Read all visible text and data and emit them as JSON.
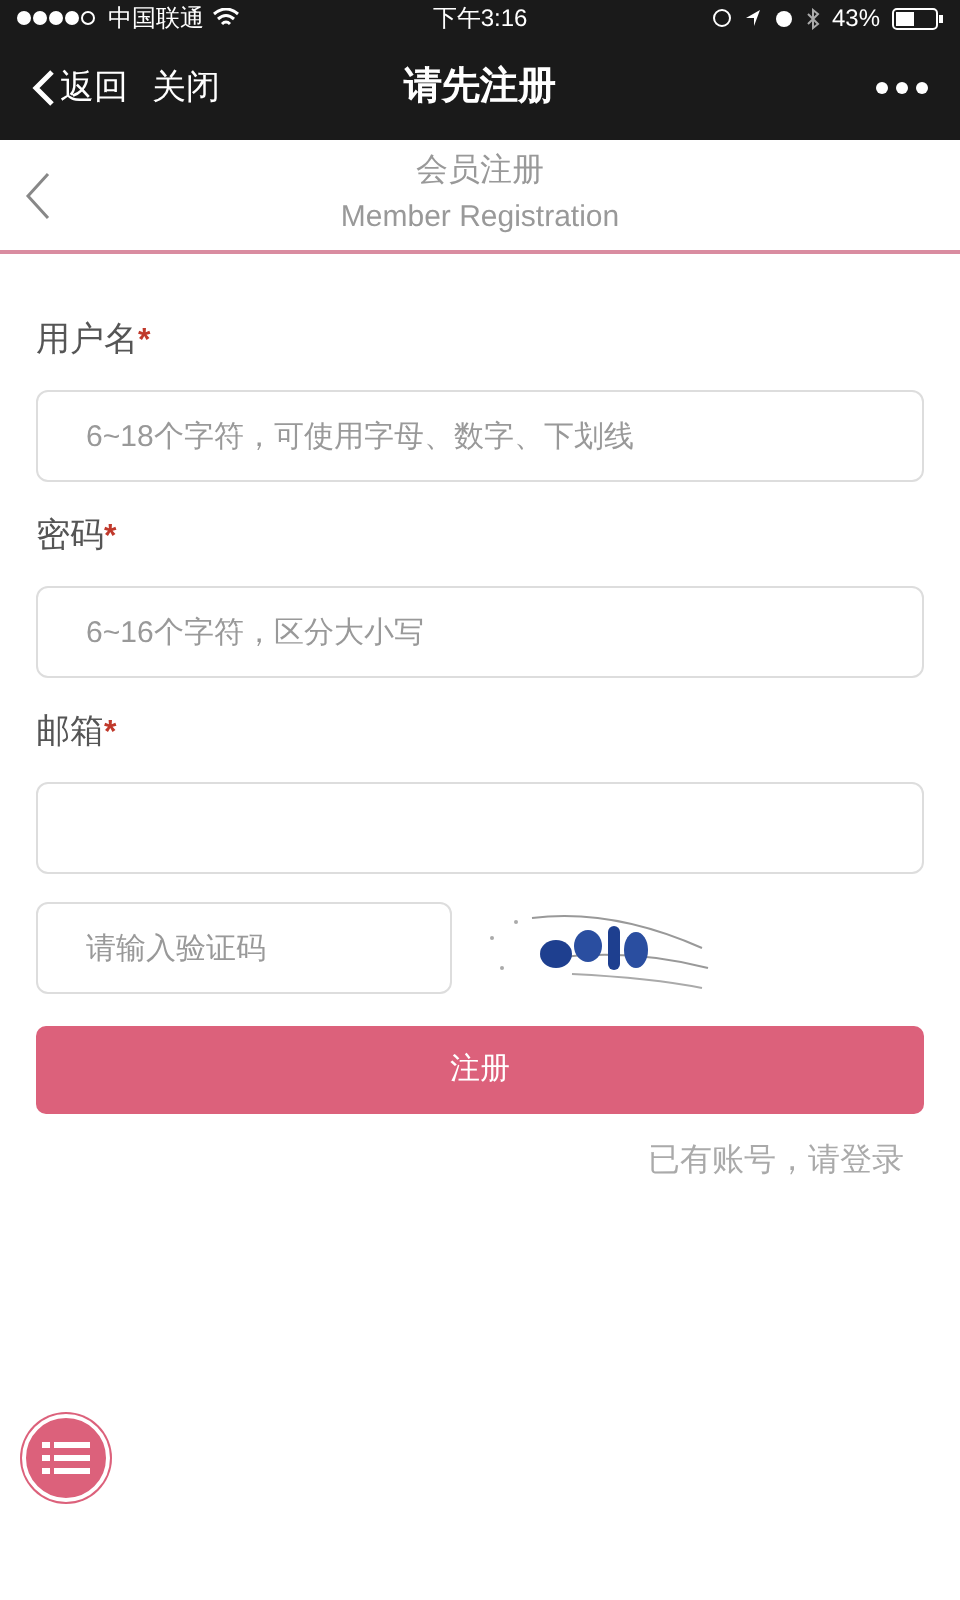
{
  "status_bar": {
    "carrier": "中国联通",
    "time": "下午3:16",
    "battery": "43%"
  },
  "nav_bar": {
    "back": "返回",
    "close": "关闭",
    "title": "请先注册"
  },
  "header": {
    "title": "会员注册",
    "subtitle": "Member Registration"
  },
  "fields": [
    {
      "label": "用户名",
      "required_mark": "*",
      "placeholder": "6~18个字符，可使用字母、数字、下划线"
    },
    {
      "label": "密码",
      "required_mark": "*",
      "placeholder": "6~16个字符，区分大小写"
    },
    {
      "label": "邮箱",
      "required_mark": "*"
    }
  ],
  "captcha": {
    "placeholder": "请输入验证码"
  },
  "submit": "注册",
  "login_link": "已有账号，请登录"
}
